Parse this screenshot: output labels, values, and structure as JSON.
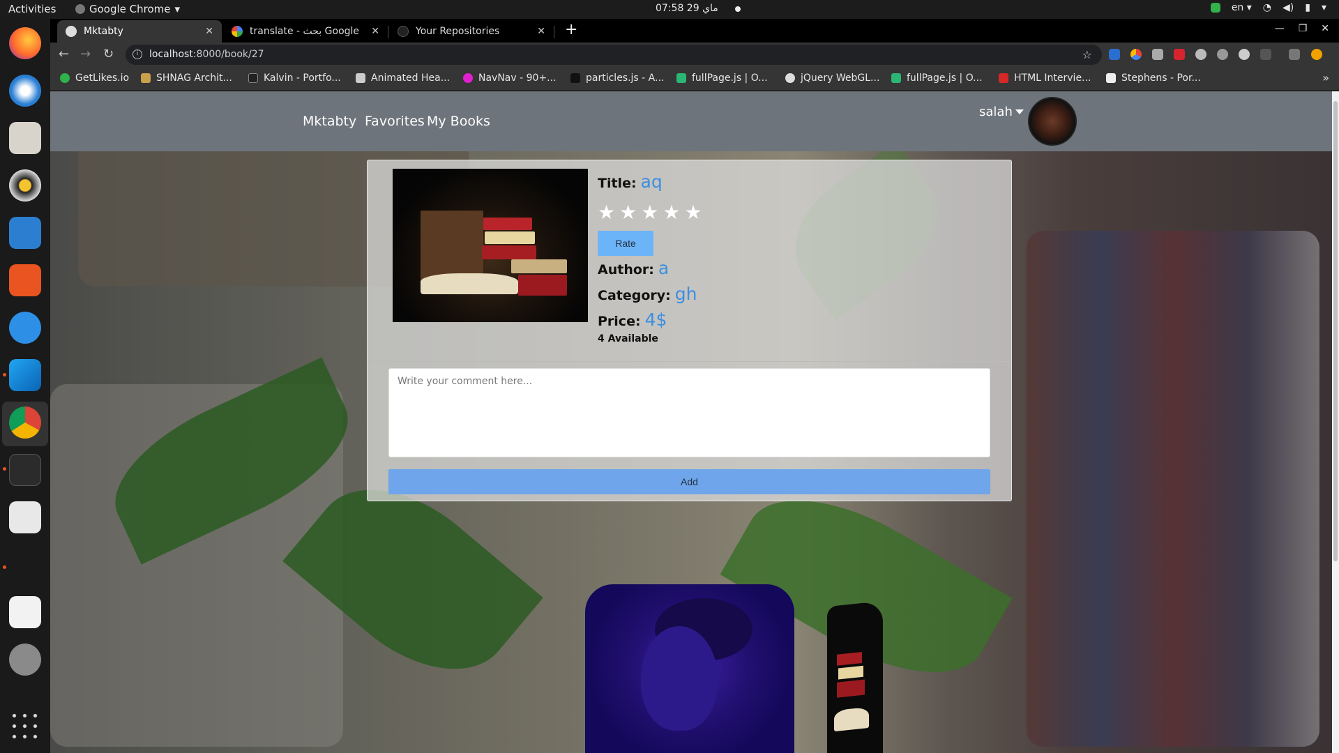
{
  "os": {
    "activities": "Activities",
    "app_name": "Google Chrome",
    "clock": "07:58  29 ماي",
    "lang": "en"
  },
  "tabs": [
    {
      "title": "Mktabty",
      "active": true
    },
    {
      "title": "translate - بحث Google",
      "active": false
    },
    {
      "title": "Your Repositories",
      "active": false
    }
  ],
  "address": {
    "host": "localhost",
    "path": ":8000/book/27"
  },
  "bookmarks": [
    {
      "label": "GetLikes.io",
      "color": "#2fb24c"
    },
    {
      "label": "SHNAG Archit...",
      "color": "#c9a14a"
    },
    {
      "label": "Kalvin - Portfo...",
      "color": "#222222"
    },
    {
      "label": "Animated Hea...",
      "color": "#cccccc"
    },
    {
      "label": "NavNav - 90+...",
      "color": "#e020d0"
    },
    {
      "label": "particles.js - A...",
      "color": "#111111"
    },
    {
      "label": "fullPage.js | O...",
      "color": "#2bb673"
    },
    {
      "label": "jQuery WebGL...",
      "color": "#dddddd"
    },
    {
      "label": "fullPage.js | O...",
      "color": "#2bb673"
    },
    {
      "label": "HTML Intervie...",
      "color": "#d62828"
    },
    {
      "label": "Stephens - Por...",
      "color": "#eeeeee"
    }
  ],
  "navbar": {
    "brand": "Mktabty",
    "links": [
      "Favorites",
      "My Books"
    ],
    "user": "salah"
  },
  "book": {
    "title_label": "Title:",
    "title": "aq",
    "rating_stars": 5,
    "rate_button": "Rate",
    "author_label": "Author:",
    "author": "a",
    "category_label": "Category:",
    "category": "gh",
    "price_label": "Price:",
    "price": "4$",
    "availability": "4 Available"
  },
  "comment": {
    "placeholder": "Write your comment here...",
    "value": "",
    "add_button": "Add"
  }
}
